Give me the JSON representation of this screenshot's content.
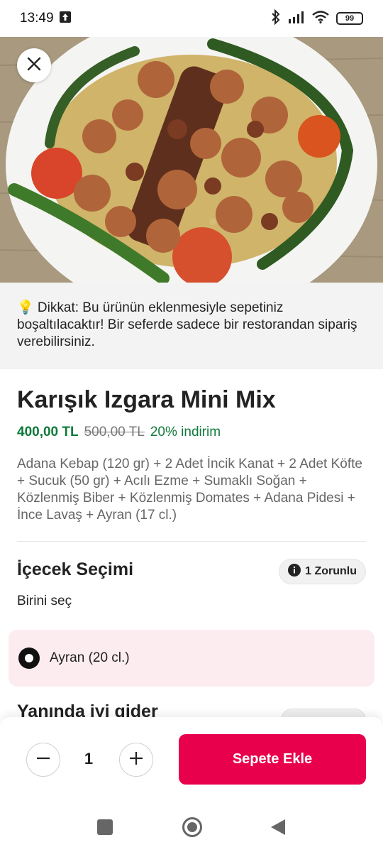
{
  "status": {
    "time": "13:49",
    "battery": "99"
  },
  "notice": {
    "text": "💡 Dikkat: Bu ürünün eklenmesiyle sepetiniz boşaltılacaktır! Bir seferde sadece bir restorandan sipariş verebilirsiniz."
  },
  "product": {
    "title": "Karışık Izgara Mini Mix",
    "price": "400,00 TL",
    "old_price": "500,00 TL",
    "discount": "20% indirim",
    "description": "Adana Kebap (120 gr) + 2 Adet İncik Kanat + 2 Adet Köfte + Sucuk (50 gr) + Acılı Ezme + Sumaklı Soğan + Közlenmiş Biber + Közlenmiş Domates + Adana Pidesi + İnce Lavaş + Ayran (17 cl.)"
  },
  "drink_section": {
    "title": "İçecek Seçimi",
    "badge": "1 Zorunlu",
    "subtitle": "Birini seç",
    "option": "Ayran (20 cl.)"
  },
  "next_section": {
    "title": "Yanında iyi gider"
  },
  "cart": {
    "quantity": "1",
    "add_label": "Sepete Ekle"
  },
  "colors": {
    "accent": "#e8004c",
    "price_green": "#0f7a3a",
    "option_bg": "#fdecef"
  }
}
